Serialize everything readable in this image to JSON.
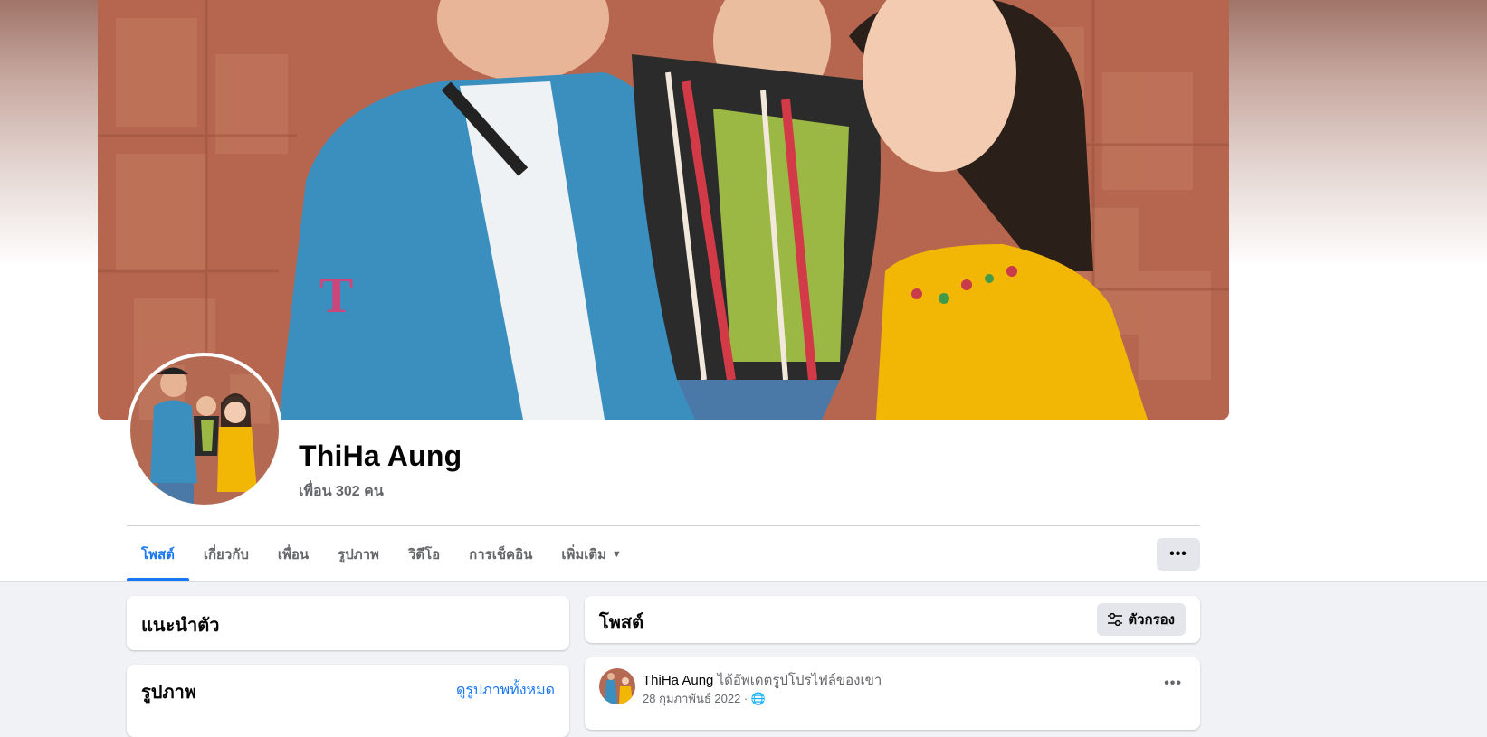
{
  "profile": {
    "name": "ThiHa Aung",
    "friends": "เพื่อน 302 คน"
  },
  "tabs": [
    {
      "label": "โพสต์",
      "active": true
    },
    {
      "label": "เกี่ยวกับ"
    },
    {
      "label": "เพื่อน"
    },
    {
      "label": "รูปภาพ"
    },
    {
      "label": "วิดีโอ"
    },
    {
      "label": "การเช็คอิน"
    },
    {
      "label": "เพิ่มเติม"
    }
  ],
  "icons": {
    "more_button": "more-horizontal-icon",
    "more_caret": "caret-down-icon",
    "filter": "filter-sliders-icon",
    "post_menu": "more-horizontal-icon",
    "audience": "globe-icon"
  },
  "intro": {
    "title": "แนะนำตัว"
  },
  "photos": {
    "title": "รูปภาพ",
    "see_all": "ดูรูปภาพทั้งหมด"
  },
  "posts": {
    "title": "โพสต์",
    "filter_label": "ตัวกรอง"
  },
  "post": {
    "author": "ThiHa Aung",
    "action": "ได้อัพเดตรูปโปรไฟล์ของเขา",
    "date": "28 กุมภาพันธ์ 2022 · 🌐"
  },
  "colors": {
    "accent": "#1877f2",
    "background": "#f0f2f5",
    "secondary_text": "#65676b",
    "button_bg": "#e4e6eb"
  }
}
